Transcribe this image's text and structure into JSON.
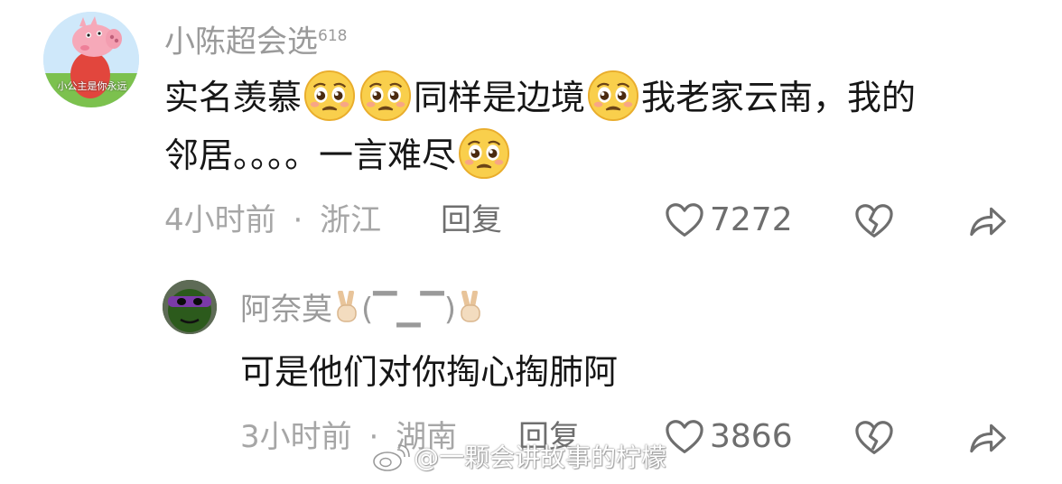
{
  "comment": {
    "username": "小陈超会选",
    "badge": "618",
    "avatar_caption": "小公主是你永远",
    "text_line1_a": "实名羡慕",
    "text_line1_b": "同样是边境",
    "text_line1_c": "我老家云南，我的",
    "text_line2": "邻居。。。。一言难尽",
    "emoji_name": "pleading-face-emoji",
    "time": "4小时前",
    "sep": "·",
    "location": "浙江",
    "reply_label": "回复",
    "like_count": "7272"
  },
  "reply": {
    "username_prefix": "阿奈莫",
    "kaomoji": "(▔▁▔)",
    "text": "可是他们对你掏心掏肺阿",
    "time": "3小时前",
    "sep": "·",
    "location": "湖南",
    "reply_label": "回复",
    "like_count": "3866"
  },
  "watermark": "@一颗会讲故事的柠檬",
  "icons": [
    "heart-outline-icon",
    "broken-heart-icon",
    "share-arrow-icon",
    "weibo-logo-icon",
    "victory-hand-emoji"
  ],
  "colors": {
    "text": "#161616",
    "meta": "#a6a6a6",
    "username": "#9a9a9a",
    "icon": "#6e6e6e",
    "emoji": "#f7c948"
  }
}
